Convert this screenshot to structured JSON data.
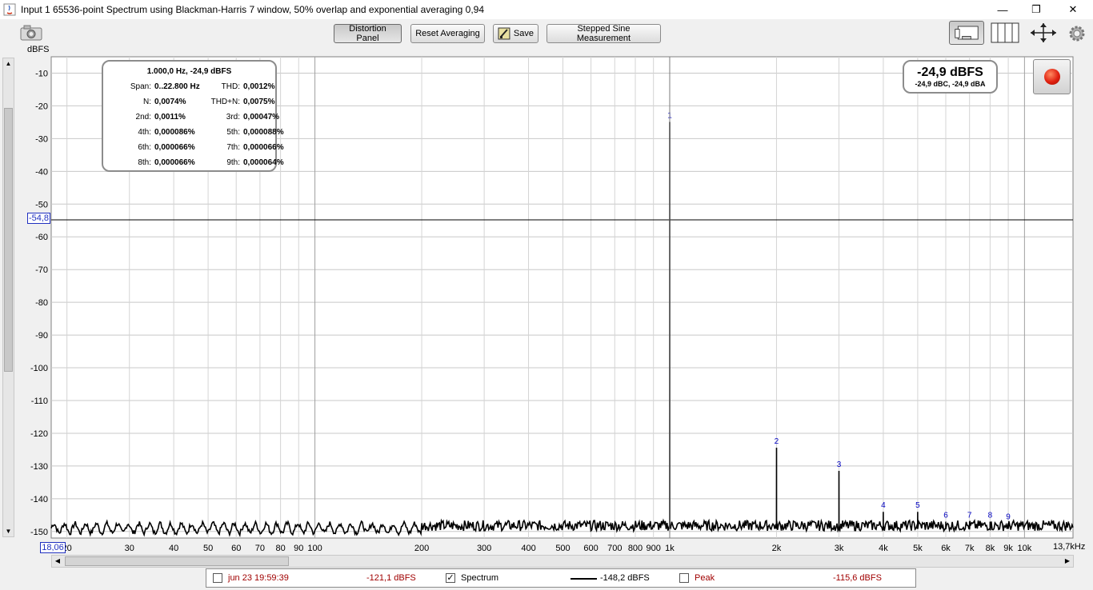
{
  "window": {
    "title": "Input 1 65536-point Spectrum using Blackman-Harris 7 window, 50% overlap and exponential averaging 0,94",
    "minimize": "—",
    "restore": "❐",
    "close": "✕"
  },
  "toolbar": {
    "distortion_panel": "Distortion Panel",
    "reset_averaging": "Reset Averaging",
    "save": "Save",
    "stepped_sine": "Stepped Sine Measurement"
  },
  "axis": {
    "y_unit": "dBFS",
    "x_unit_suffix": "13,7kHz",
    "cursor_y_label": "-54,8",
    "cursor_x_label": "18,06"
  },
  "distortion_panel": {
    "header": "1.000,0 Hz, -24,9 dBFS",
    "rows": [
      {
        "l1": "Span:",
        "v1": "0..22.800 Hz",
        "l2": "THD:",
        "v2": "0,0012%"
      },
      {
        "l1": "N:",
        "v1": "0,0074%",
        "l2": "THD+N:",
        "v2": "0,0075%"
      },
      {
        "l1": "2nd:",
        "v1": "0,0011%",
        "l2": "3rd:",
        "v2": "0,00047%"
      },
      {
        "l1": "4th:",
        "v1": "0,000086%",
        "l2": "5th:",
        "v2": "0,000088%"
      },
      {
        "l1": "6th:",
        "v1": "0,000066%",
        "l2": "7th:",
        "v2": "0,000066%"
      },
      {
        "l1": "8th:",
        "v1": "0,000066%",
        "l2": "9th:",
        "v2": "0,000064%"
      }
    ]
  },
  "level_box": {
    "main": "-24,9 dBFS",
    "sub": "-24,9 dBC, -24,9 dBA"
  },
  "legend": {
    "capture_time": "jun 23 19:59:39",
    "capture_value": "-121,1 dBFS",
    "spectrum_label": "Spectrum",
    "spectrum_value": "-148,2 dBFS",
    "peak_label": "Peak",
    "peak_value": "-115,6 dBFS",
    "spectrum_checked": "✓"
  },
  "colors": {
    "trace": "#000000",
    "marker_text": "#0000c0",
    "capture_text": "#a00000",
    "record_button": "#e02010"
  },
  "chart_data": {
    "type": "line",
    "title": "",
    "xlabel": "",
    "ylabel": "dBFS",
    "x_scale": "log",
    "xlim": [
      18.06,
      13700
    ],
    "ylim": [
      -152,
      -5
    ],
    "y_ticks": [
      -10,
      -20,
      -30,
      -40,
      -50,
      -60,
      -70,
      -80,
      -90,
      -100,
      -110,
      -120,
      -130,
      -140,
      -150
    ],
    "y_tick_labels": [
      "-10",
      "-20",
      "-30",
      "-40",
      "-50",
      "-60",
      "-70",
      "-80",
      "-90",
      "-100",
      "-110",
      "-120",
      "-130",
      "-140",
      "-150"
    ],
    "x_ticks": [
      20,
      30,
      40,
      50,
      60,
      70,
      80,
      90,
      100,
      200,
      300,
      400,
      500,
      600,
      700,
      800,
      900,
      1000,
      2000,
      3000,
      4000,
      5000,
      6000,
      7000,
      8000,
      9000,
      10000
    ],
    "x_tick_labels": [
      "20",
      "30",
      "40",
      "50",
      "60",
      "70",
      "80",
      "90",
      "100",
      "200",
      "300",
      "400",
      "500",
      "600",
      "700",
      "800",
      "900",
      "1k",
      "2k",
      "3k",
      "4k",
      "5k",
      "6k",
      "7k",
      "8k",
      "9k",
      "10k"
    ],
    "cursor_level": -54.8,
    "cursor_freq": 1000,
    "noise_floor": -148.2,
    "series": [
      {
        "values_note": "",
        "peaks": [
          {
            "label": "1",
            "freq": 1000,
            "level": -24.9
          },
          {
            "label": "2",
            "freq": 2000,
            "level": -124.4
          },
          {
            "label": "3",
            "freq": 3000,
            "level": -131.5
          },
          {
            "label": "4",
            "freq": 4000,
            "level": -144.0
          },
          {
            "label": "5",
            "freq": 5000,
            "level": -144.0
          },
          {
            "label": "6",
            "freq": 6000,
            "level": -147.0
          },
          {
            "label": "7",
            "freq": 7000,
            "level": -147.0
          },
          {
            "label": "8",
            "freq": 8000,
            "level": -147.0
          },
          {
            "label": "9",
            "freq": 9000,
            "level": -147.5
          }
        ]
      }
    ],
    "grid": true
  }
}
